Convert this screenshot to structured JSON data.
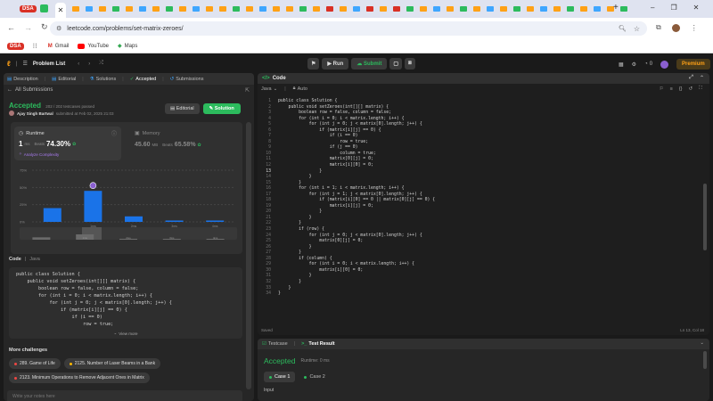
{
  "browser": {
    "dsa_badge": "DSA",
    "url": "leetcode.com/problems/set-matrix-zeroes/",
    "bookmarks": {
      "dsa": "DSA",
      "gmail": "Gmail",
      "youtube": "YouTube",
      "maps": "Maps"
    }
  },
  "appnav": {
    "problem_list": "Problem List",
    "run": "Run",
    "submit": "Submit",
    "streak": "0",
    "premium": "Premium"
  },
  "left": {
    "tabs": [
      "Description",
      "Editorial",
      "Solutions",
      "Accepted",
      "Submissions"
    ],
    "all_submissions": "All Submissions",
    "status": "Accepted",
    "testcases": "202 / 202 testcases passed",
    "author": "Ajay Singh Bartwal",
    "submitted": "submitted at Feb 02, 2025 21:03",
    "editorial_btn": "Editorial",
    "solution_btn": "Solution",
    "runtime": {
      "label": "Runtime",
      "value": "1",
      "unit": "ms",
      "beats_label": "Beats",
      "beats": "74.30%",
      "analyze": "Analyze Complexity"
    },
    "memory": {
      "label": "Memory",
      "value": "45.60",
      "unit": "MB",
      "beats_label": "Beats",
      "beats": "65.58%"
    },
    "chart_data": {
      "type": "bar",
      "categories": [
        "",
        "1ms",
        "2ms",
        "3ms",
        "4ms"
      ],
      "values": [
        20,
        45,
        8,
        2,
        2
      ],
      "y_ticks": [
        "75%",
        "50%",
        "25%",
        "0%"
      ],
      "ylim": [
        0,
        75
      ],
      "highlight_index": 1,
      "mini_labels": [
        "",
        "1ms",
        "2ms",
        "3ms",
        "4ms"
      ]
    },
    "code_label": "Code",
    "lang_label": "Java",
    "code_preview": [
      "public class Solution {",
      "    public void setZeroes(int[][] matrix) {",
      "        boolean row = false, column = false;",
      "        for (int i = 0; i < matrix.length; i++) {",
      "            for (int j = 0; j < matrix[0].length; j++) {",
      "                if (matrix[i][j] == 0) {",
      "                    if (i == 0)",
      "                        row = true;"
    ],
    "view_more": "View more",
    "more_challenges": "More challenges",
    "challenges": [
      "289. Game of Life",
      "2125. Number of Laser Beams in a Bank",
      "2123. Minimum Operations to Remove Adjacent Ones in Matrix"
    ],
    "notes_placeholder": "Write your notes here"
  },
  "code": {
    "title": "Code",
    "lang": "Java",
    "auto": "Auto",
    "lines": [
      "public class Solution {",
      "    public void setZeroes(int[][] matrix) {",
      "        boolean row = false, column = false;",
      "        for (int i = 0; i < matrix.length; i++) {",
      "            for (int j = 0; j < matrix[0].length; j++) {",
      "                if (matrix[i][j] == 0) {",
      "                    if (i == 0)",
      "                        row = true;",
      "                    if (j == 0)",
      "                        column = true;",
      "                    matrix[0][j] = 0;",
      "                    matrix[i][0] = 0;",
      "                }",
      "            }",
      "        }",
      "        for (int i = 1; i < matrix.length; i++) {",
      "            for (int j = 1; j < matrix[0].length; j++) {",
      "                if (matrix[i][0] == 0 || matrix[0][j] == 0) {",
      "                    matrix[i][j] = 0;",
      "                }",
      "            }",
      "        }",
      "        if (row) {",
      "            for (int j = 0; j < matrix[0].length; j++) {",
      "                matrix[0][j] = 0;",
      "            }",
      "        }",
      "        if (column) {",
      "            for (int i = 0; i < matrix.length; i++) {",
      "                matrix[i][0] = 0;",
      "            }",
      "        }",
      "    }",
      "}"
    ],
    "saved": "Saved",
    "cursor": "Ln 13, Col 18"
  },
  "result": {
    "tab_testcase": "Testcase",
    "tab_result": "Test Result",
    "status": "Accepted",
    "runtime": "Runtime: 0 ms",
    "cases": [
      "Case 1",
      "Case 2"
    ],
    "input_label": "Input"
  },
  "colors": {
    "accent_green": "#2cbb5d",
    "brand_orange": "#ffa116",
    "bar_blue": "#1a73e8"
  }
}
